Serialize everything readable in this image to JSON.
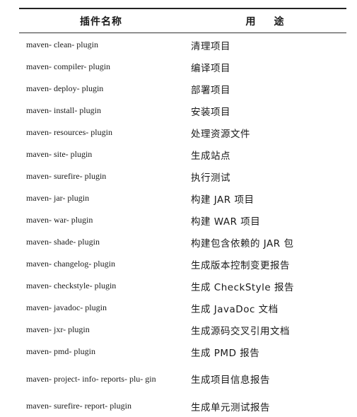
{
  "table": {
    "header": {
      "col_name": "插件名称",
      "col_use": "用途"
    },
    "rows": [
      {
        "name": "maven- clean- plugin",
        "use": "清理项目"
      },
      {
        "name": "maven- compiler- plugin",
        "use": "编译项目"
      },
      {
        "name": "maven- deploy- plugin",
        "use": "部署项目"
      },
      {
        "name": "maven- install- plugin",
        "use": "安装项目"
      },
      {
        "name": "maven- resources- plugin",
        "use": "处理资源文件"
      },
      {
        "name": "maven- site- plugin",
        "use": "生成站点"
      },
      {
        "name": "maven- surefire- plugin",
        "use": "执行测试"
      },
      {
        "name": "maven- jar- plugin",
        "use": "构建 JAR 项目"
      },
      {
        "name": "maven- war- plugin",
        "use": "构建 WAR 项目"
      },
      {
        "name": "maven- shade- plugin",
        "use": "构建包含依赖的 JAR 包"
      },
      {
        "name": "maven- changelog- plugin",
        "use": "生成版本控制变更报告"
      },
      {
        "name": "maven- checkstyle- plugin",
        "use": "生成 CheckStyle 报告"
      },
      {
        "name": "maven- javadoc- plugin",
        "use": "生成 JavaDoc 文档"
      },
      {
        "name": "maven- jxr- plugin",
        "use": "生成源码交叉引用文档"
      },
      {
        "name": "maven- pmd- plugin",
        "use": "生成 PMD 报告"
      },
      {
        "name": "maven- project- info- reports- plu- gin",
        "use": "生成项目信息报告"
      },
      {
        "name": "maven- surefire- report- plugin",
        "use": "生成单元测试报告"
      }
    ]
  }
}
